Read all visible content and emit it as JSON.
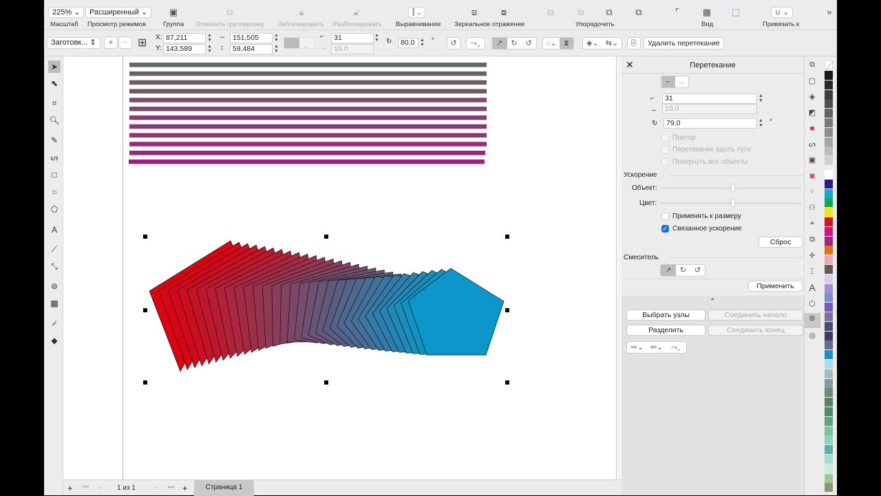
{
  "toolbar": {
    "zoom": "225%",
    "view_mode": "Расширенный",
    "labels": {
      "zoom": "Масштаб",
      "view_modes": "Просмотр режимов",
      "group": "Группа",
      "ungroup": "Отменить группировку",
      "lock": "Заблокировать",
      "unlock": "Разблокировать",
      "align": "Выравнивание",
      "mirror": "Зеркальное отражение",
      "arrange": "Упорядочить",
      "view": "Вид",
      "snap": "Привязать к"
    }
  },
  "propbar": {
    "preset": "Заготовк...",
    "x": "87,211",
    "y": "143,589",
    "width": "151,505",
    "height": "59,484",
    "steps": "31",
    "spacing": "10,0",
    "rotation": "80,0",
    "degree": "°",
    "delete_blend": "Удалить перетекание"
  },
  "docker": {
    "title": "Перетекание",
    "steps": "31",
    "spacing": "10,0",
    "rotation": "79,0",
    "degree": "°",
    "loop": "Повтор",
    "blend_along_path": "Перетекание вдоль пути",
    "rotate_all": "Повернуть все объекты",
    "acceleration": "Ускорение",
    "object": "Объект:",
    "color": "Цвет:",
    "apply_to_size": "Применять к размеру",
    "linked_acceleration": "Связанное ускорение",
    "reset": "Сброс",
    "mixer": "Смеситель",
    "apply": "Применить",
    "select_nodes": "Выбрать узлы",
    "fuse_start": "Соединить начало",
    "split": "Разделить",
    "fuse_end": "Соединить конец",
    "object_accel": 0.5,
    "color_accel": 0.5,
    "linked_checked": true
  },
  "pages": {
    "current": "1 из 1",
    "tab": "Страница 1"
  },
  "blend": {
    "steps": 31,
    "start_color": "#e0000f",
    "end_color": "#0b97c9"
  },
  "stripes": {
    "count": 12,
    "start_color": "#5f6b60",
    "end_color": "#a41c80"
  },
  "palette": [
    "#1a1a1a",
    "#2b2b2b",
    "#3d3d3d",
    "#505050",
    "#646464",
    "#7a7a7a",
    "#8f8f8f",
    "#a5a5a5",
    "#bcbcbc",
    "#d0d0d0",
    "#ffffff",
    "#2e1a8a",
    "#12a9d6",
    "#13a84c",
    "#f2e21a",
    "#d3141c",
    "#d4127c",
    "#9b2a7e",
    "#e8700f",
    "#f4a9b4",
    "#6b5a4e",
    "#d8cdf0",
    "#a88fd8",
    "#7b8fd2",
    "#7a56c0",
    "#7e6ea0",
    "#444e76",
    "#3e3c5a",
    "#5a7090",
    "#1494c8",
    "#a9dcef",
    "#a6bcc4",
    "#8899a0",
    "#6e8a7a",
    "#5c7c6c",
    "#4e8a6a",
    "#5fa27e",
    "#7fc0a0",
    "#8ad4c0",
    "#5fb0a8",
    "#9fe0d0",
    "#c4f0d4",
    "#a0c890",
    "#8a9a70"
  ]
}
